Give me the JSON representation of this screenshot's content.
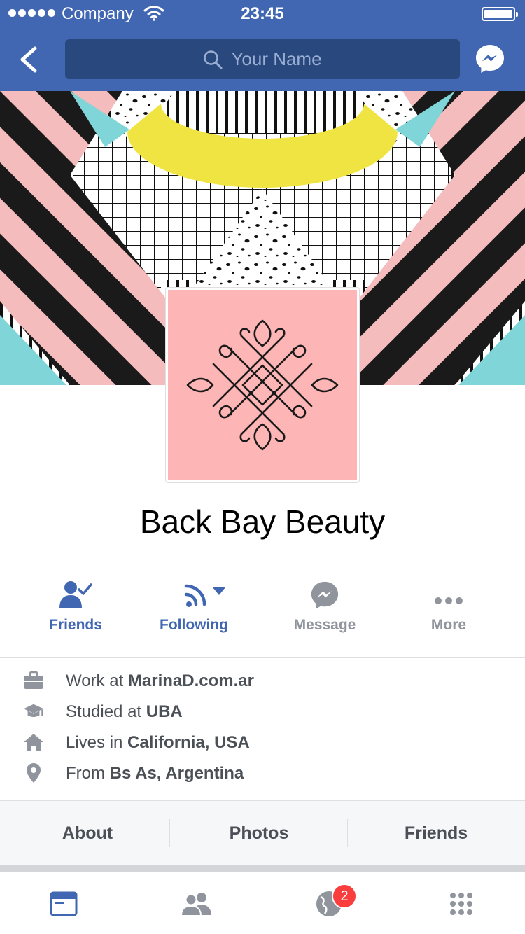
{
  "status_bar": {
    "carrier": "Company",
    "time": "23:45"
  },
  "nav": {
    "search_placeholder": "Your Name"
  },
  "profile": {
    "page_name": "Back Bay Beauty"
  },
  "actions": [
    {
      "label": "Friends",
      "icon": "friends-check-icon",
      "color": "#4267b2"
    },
    {
      "label": "Following",
      "icon": "rss-follow-icon",
      "color": "#4267b2"
    },
    {
      "label": "Message",
      "icon": "messenger-icon",
      "color": "#90949c"
    },
    {
      "label": "More",
      "icon": "more-dots-icon",
      "color": "#90949c"
    }
  ],
  "intro": [
    {
      "icon": "briefcase-icon",
      "prefix": "Work at ",
      "value": "MarinaD.com.ar"
    },
    {
      "icon": "graduation-cap-icon",
      "prefix": "Studied at ",
      "value": "UBA"
    },
    {
      "icon": "home-icon",
      "prefix": "Lives in ",
      "value": "California, USA"
    },
    {
      "icon": "location-pin-icon",
      "prefix": "From ",
      "value": "Bs As, Argentina"
    }
  ],
  "tabs": [
    "About",
    "Photos",
    "Friends"
  ],
  "tab_bar": {
    "notifications_badge": "2"
  },
  "colors": {
    "brand": "#4267b2",
    "search_bg": "#29487d",
    "profile_pink": "#fdb5b5",
    "cover_pink": "#f4bcbc",
    "cover_yellow": "#f0e443",
    "cover_teal": "#7fd5d7",
    "badge_red": "#fa3e3e"
  }
}
